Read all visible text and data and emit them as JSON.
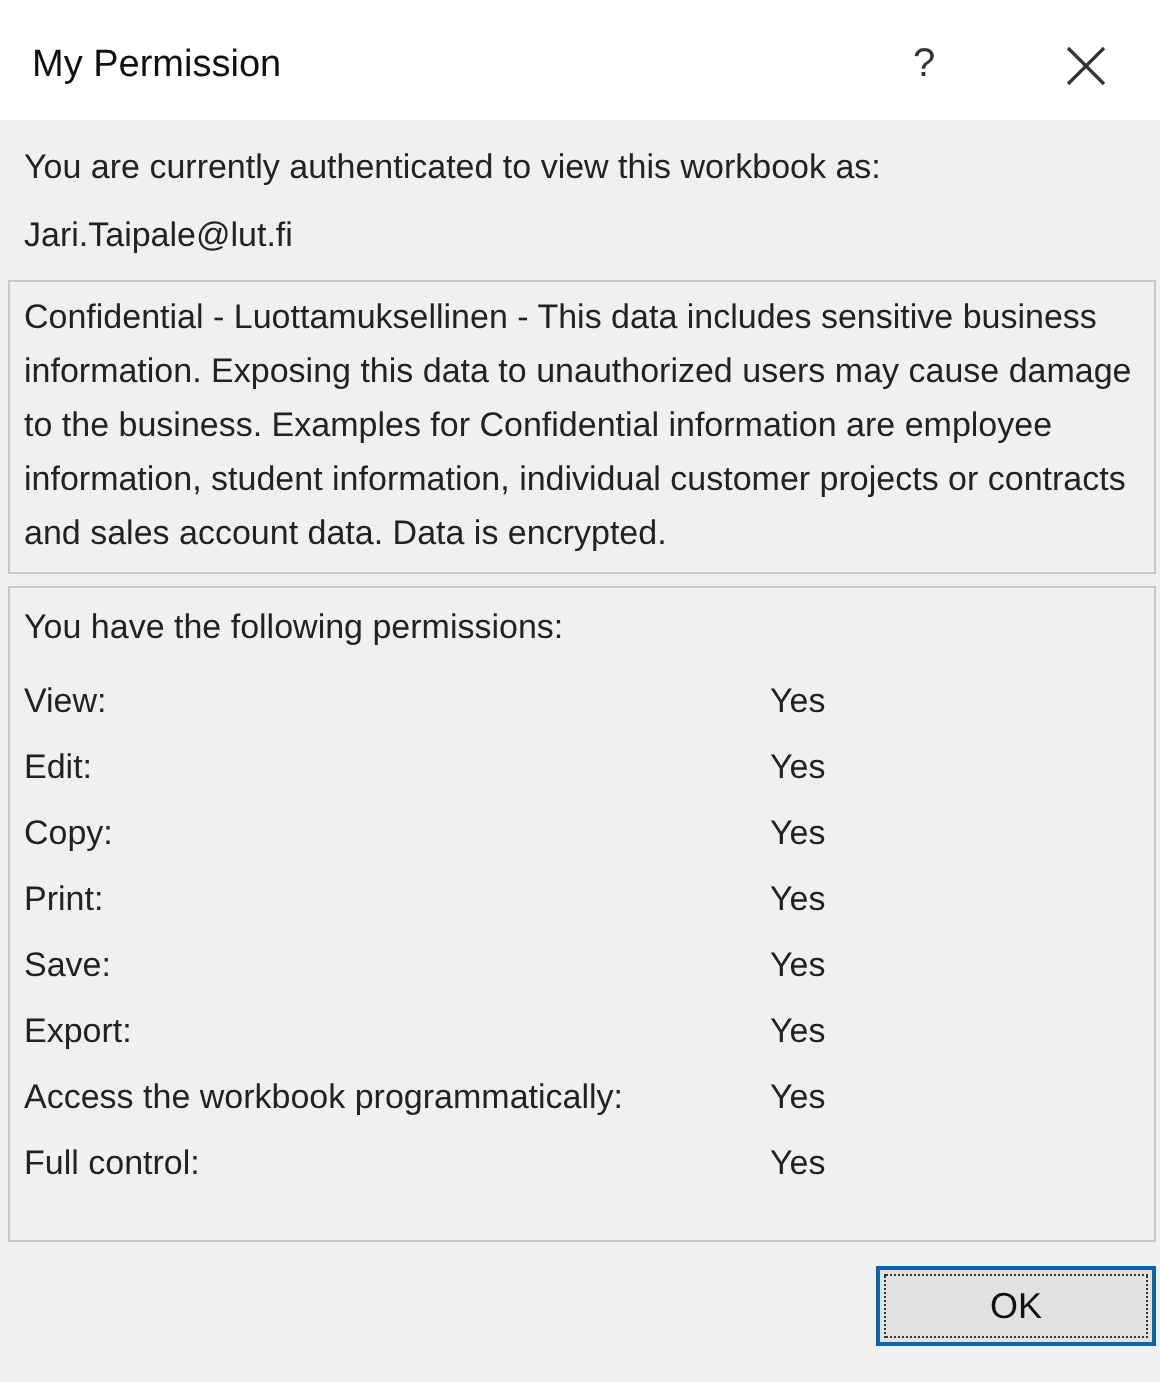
{
  "window": {
    "title": "My Permission",
    "help": "?"
  },
  "intro": "You are currently authenticated to view this workbook as:",
  "user": "Jari.Taipale@lut.fi",
  "classification": "Confidential - Luottamuksellinen - This data includes sensitive business information. Exposing this data to unauthorized users may cause damage to the business. Examples for Confidential information are employee information, student information, individual customer projects or contracts and sales account data. Data is encrypted.",
  "permissions": {
    "heading": "You have the following permissions:",
    "rows": [
      {
        "label": "View:",
        "value": "Yes"
      },
      {
        "label": "Edit:",
        "value": "Yes"
      },
      {
        "label": "Copy:",
        "value": "Yes"
      },
      {
        "label": "Print:",
        "value": "Yes"
      },
      {
        "label": "Save:",
        "value": "Yes"
      },
      {
        "label": "Export:",
        "value": "Yes"
      },
      {
        "label": "Access the workbook programmatically:",
        "value": "Yes"
      },
      {
        "label": "Full control:",
        "value": "Yes"
      }
    ]
  },
  "buttons": [
    "OK"
  ]
}
